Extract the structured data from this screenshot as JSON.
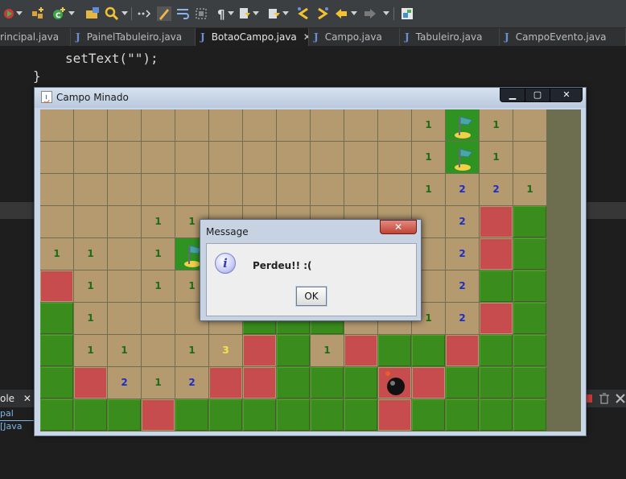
{
  "ide": {
    "code_line1": "setText(\"\");",
    "code_line2": "}",
    "tabs": [
      {
        "label": "rincipal.java",
        "active": false
      },
      {
        "label": "PainelTabuleiro.java",
        "active": false
      },
      {
        "label": "BotaoCampo.java",
        "active": true
      },
      {
        "label": "Campo.java",
        "active": false
      },
      {
        "label": "Tabuleiro.java",
        "active": false
      },
      {
        "label": "CampoEvento.java",
        "active": false
      }
    ],
    "console_tab_label": "ole",
    "console_sub_label": "pal [Java",
    "toolbar_icons": [
      "debug-run-icon",
      "new-package-icon",
      "new-class-icon",
      "open-folder-icon",
      "search-icon",
      "toggle-icon",
      "pen-icon",
      "wrap-icon",
      "block-select-icon",
      "pilcrow-icon",
      "annotation-icon",
      "next-annotation-icon",
      "prev-edit-icon",
      "next-edit-icon",
      "back-icon",
      "forward-icon",
      "pin-icon"
    ]
  },
  "game_window": {
    "title": "Campo Minado",
    "board": {
      "rows": [
        [
          "o",
          "o",
          "o",
          "o",
          "o",
          "o",
          "o",
          "o",
          "o",
          "o",
          "o",
          "o:1",
          "f",
          "o:1",
          "o"
        ],
        [
          "o",
          "o",
          "o",
          "o",
          "o",
          "o",
          "o",
          "o",
          "o",
          "o",
          "o",
          "o:1",
          "f",
          "o:1",
          "o"
        ],
        [
          "o",
          "o",
          "o",
          "o",
          "o",
          "o",
          "o",
          "o",
          "o",
          "o",
          "o",
          "o:1",
          "o:2",
          "o:2",
          "o:1"
        ],
        [
          "o",
          "o",
          "o",
          "o:1",
          "o:1",
          "o",
          "o",
          "o",
          "o",
          "o",
          "o",
          "o",
          "o:2",
          "r",
          "c"
        ],
        [
          "o:1",
          "o:1",
          "o",
          "o:1",
          "f",
          "o",
          "o",
          "o",
          "o",
          "o",
          "o",
          "o",
          "o:2",
          "r",
          "c"
        ],
        [
          "r",
          "o:1",
          "o",
          "o:1",
          "o:1",
          "o",
          "o",
          "o",
          "o",
          "o",
          "o",
          "o",
          "o:2",
          "c",
          "c"
        ],
        [
          "c",
          "o:1",
          "o",
          "o",
          "o",
          "o",
          "c",
          "c",
          "c",
          "o",
          "o:1",
          "o:1",
          "o:2",
          "r",
          "c"
        ],
        [
          "c",
          "o:1",
          "o:1",
          "o",
          "o:1",
          "o:3",
          "r",
          "c",
          "o:1",
          "r",
          "c",
          "c",
          "r",
          "c",
          "c"
        ],
        [
          "c",
          "r",
          "o:2",
          "o:1",
          "o:2",
          "r",
          "r",
          "c",
          "c",
          "c",
          "b",
          "r",
          "c",
          "c",
          "c"
        ],
        [
          "c",
          "c",
          "c",
          "r",
          "c",
          "c",
          "c",
          "c",
          "c",
          "c",
          "r",
          "c",
          "c",
          "c",
          "c"
        ]
      ]
    },
    "buttons": {
      "minimize": "▁",
      "maximize": "▢",
      "close": "✕"
    }
  },
  "dialog": {
    "title": "Message",
    "close": "✕",
    "message": "Perdeu!! :(",
    "ok_label": "OK",
    "info_glyph": "i"
  },
  "colors": {
    "open_cell": "#b59a70",
    "closed_cell": "#3a8c1d",
    "red_cell": "#c74c4e",
    "number_1": "#1e6b12",
    "number_2": "#1b2fc4",
    "number_3": "#f2e64a"
  }
}
